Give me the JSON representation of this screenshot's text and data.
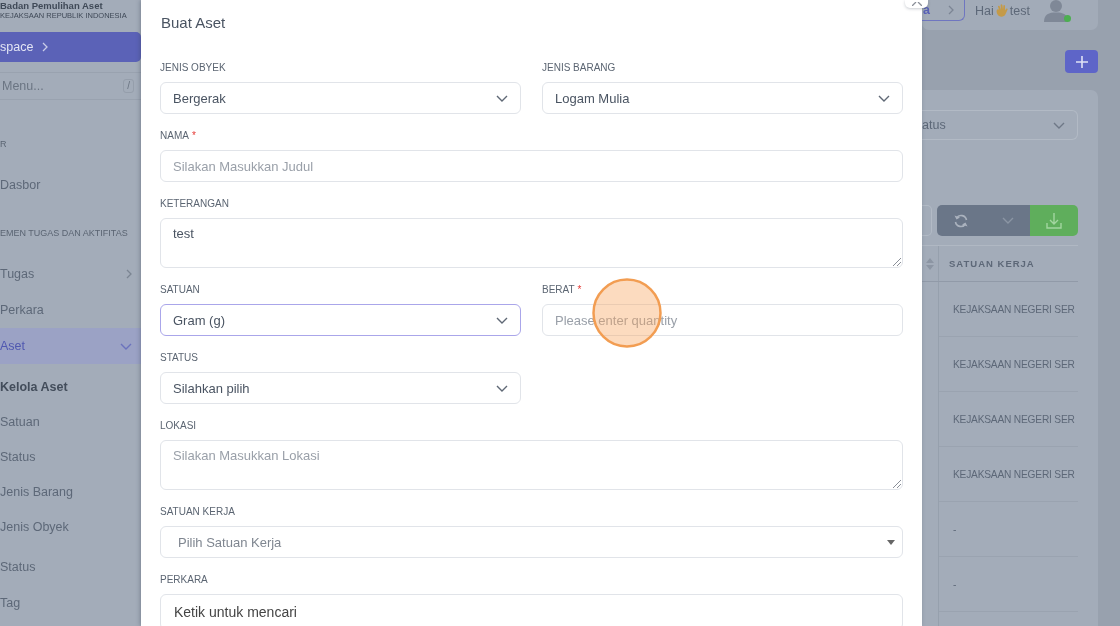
{
  "sidebar": {
    "brand": {
      "title": "Badan Pemulihan Aset",
      "subtitle": "KEJAKSAAN REPUBLIK INDONESIA"
    },
    "workspace_button": "space",
    "search": {
      "placeholder": "Menu...",
      "shortcut": "/"
    },
    "sections": [
      {
        "heading": "R",
        "items": [
          {
            "label": "Dasbor",
            "selected": false
          }
        ]
      },
      {
        "heading": "EMEN TUGAS DAN AKTIFITAS",
        "items": [
          {
            "label": "Tugas",
            "selected": false,
            "expanded": false
          },
          {
            "label": "Perkara",
            "selected": false
          },
          {
            "label": "Aset",
            "selected": true,
            "expanded": true,
            "children": [
              {
                "label": "Kelola Aset",
                "selected": true
              },
              {
                "label": "Satuan",
                "selected": false
              },
              {
                "label": "Status",
                "selected": false
              },
              {
                "label": "Jenis Barang",
                "selected": false
              },
              {
                "label": "Jenis Obyek",
                "selected": false
              }
            ]
          },
          {
            "label": "Status",
            "selected": false
          },
          {
            "label": "Tag",
            "selected": false
          }
        ]
      }
    ]
  },
  "header": {
    "breadcrumb": "a",
    "greeting": "Hai",
    "user": "test",
    "online": true
  },
  "panel": {
    "status_filter": "atus",
    "table": {
      "columns": [
        "SATUAN KERJA"
      ],
      "rows": [
        [
          "KEJAKSAAN NEGERI SER"
        ],
        [
          "KEJAKSAAN NEGERI SER"
        ],
        [
          "KEJAKSAAN NEGERI SER"
        ],
        [
          "KEJAKSAAN NEGERI SER"
        ],
        [
          "-"
        ],
        [
          "-"
        ]
      ]
    }
  },
  "modal": {
    "title": "Buat Aset",
    "rows": [
      {
        "fields": [
          {
            "kind": "select",
            "label": "JENIS OBYEK",
            "value": "Bergerak",
            "focused": false
          },
          {
            "kind": "select",
            "label": "JENIS BARANG",
            "value": "Logam Mulia",
            "focused": false
          }
        ]
      },
      {
        "fields": [
          {
            "kind": "input",
            "label": "NAMA",
            "required_mark": "*",
            "placeholder": "Silakan Masukkan Judul",
            "focused": false
          }
        ]
      },
      {
        "fields": [
          {
            "kind": "textarea",
            "label": "KETERANGAN",
            "value": "test",
            "focused": false
          }
        ]
      },
      {
        "fields": [
          {
            "kind": "select",
            "label": "SATUAN",
            "value": "Gram (g)",
            "focused": true
          },
          {
            "kind": "input",
            "label": "BERAT",
            "required_mark": "*",
            "placeholder": "Please enter quantity",
            "focused": false
          }
        ]
      },
      {
        "fields": [
          {
            "kind": "select",
            "label": "STATUS",
            "value": "Silahkan pilih",
            "focused": false
          }
        ]
      },
      {
        "fields": [
          {
            "kind": "textarea",
            "label": "LOKASI",
            "placeholder": "Silakan Masukkan Lokasi",
            "focused": false
          }
        ]
      },
      {
        "fields": [
          {
            "kind": "combo",
            "label": "SATUAN KERJA",
            "placeholder": "Pilih Satuan Kerja",
            "focused": false
          }
        ]
      },
      {
        "fields": [
          {
            "kind": "search",
            "label": "PERKARA",
            "placeholder": "Ketik untuk mencari",
            "focused": false
          }
        ]
      }
    ]
  },
  "click_highlight": true
}
